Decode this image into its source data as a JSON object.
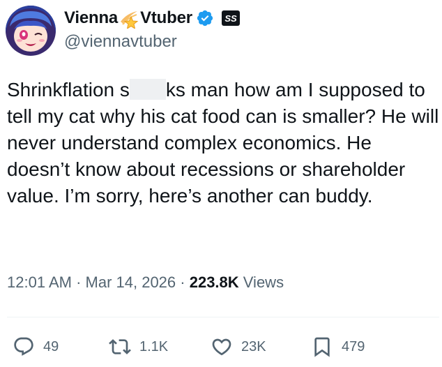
{
  "author": {
    "display_name_part1": "Vienna",
    "display_name_part2": "Vtuber",
    "handle": "@viennavtuber",
    "verified": true,
    "avatar_icon": "anime-avatar-icon",
    "name_emoji": "shooting-star-icon",
    "affiliate_badge": "affiliate-badge-icon"
  },
  "tweet": {
    "text_before": "Shrinkflation s",
    "text_after": "ks man how am I supposed to tell my cat why his cat food can is smaller? He will never understand complex economics. He doesn’t know about recessions or shareholder value. I’m sorry, here’s another can buddy."
  },
  "meta": {
    "time": "12:01 AM",
    "sep1": " · ",
    "date": "Mar 14, 2026",
    "sep2": " · ",
    "views_count": "223.8K",
    "views_label": " Views"
  },
  "actions": {
    "replies": "49",
    "reposts": "1.1K",
    "likes": "23K",
    "bookmarks": "479"
  },
  "colors": {
    "text": "#0f1419",
    "secondary": "#536471",
    "verified_blue": "#1d9bf0"
  }
}
